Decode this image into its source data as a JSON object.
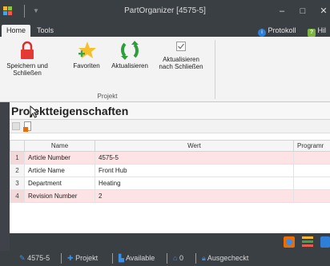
{
  "window": {
    "title": "PartOrganizer [4575-5]"
  },
  "title_controls": {
    "minimize": "–",
    "maximize": "□",
    "close": "✕"
  },
  "tabs": [
    {
      "label": "Home",
      "active": true
    },
    {
      "label": "Tools",
      "active": false
    }
  ],
  "tab_right": {
    "protokoll": "Protokoll",
    "hilfe": "Hil"
  },
  "ribbon": {
    "buttons": [
      {
        "label": "Speichern und Schließen",
        "icon": "lock-icon"
      },
      {
        "label": "Favoriten",
        "icon": "star-add-icon"
      },
      {
        "label": "Aktualisieren",
        "icon": "refresh-icon"
      },
      {
        "label": "Aktualisieren nach Schließen",
        "icon": "checkbox-icon"
      }
    ],
    "group_label": "Projekt"
  },
  "panel": {
    "title": "Projektteigenschaften"
  },
  "grid": {
    "columns": [
      "",
      "Name",
      "Wert",
      "Programr"
    ],
    "rows": [
      {
        "index": "1",
        "name": "Article Number",
        "value": "4575-5",
        "highlight": true
      },
      {
        "index": "2",
        "name": "Article Name",
        "value": "Front Hub",
        "highlight": false
      },
      {
        "index": "3",
        "name": "Department",
        "value": "Heating",
        "highlight": false
      },
      {
        "index": "4",
        "name": "Revision Number",
        "value": "2",
        "highlight": true
      }
    ]
  },
  "statusbar": {
    "article": "4575-5",
    "project": "Projekt",
    "available": "Available",
    "count": "0",
    "checkout": "Ausgecheckt"
  },
  "colors": {
    "chrome": "#3a3f44",
    "ribbon": "#f3f3f3",
    "highlight_row": "#fde3e3",
    "accent_blue": "#2f7ed8"
  }
}
